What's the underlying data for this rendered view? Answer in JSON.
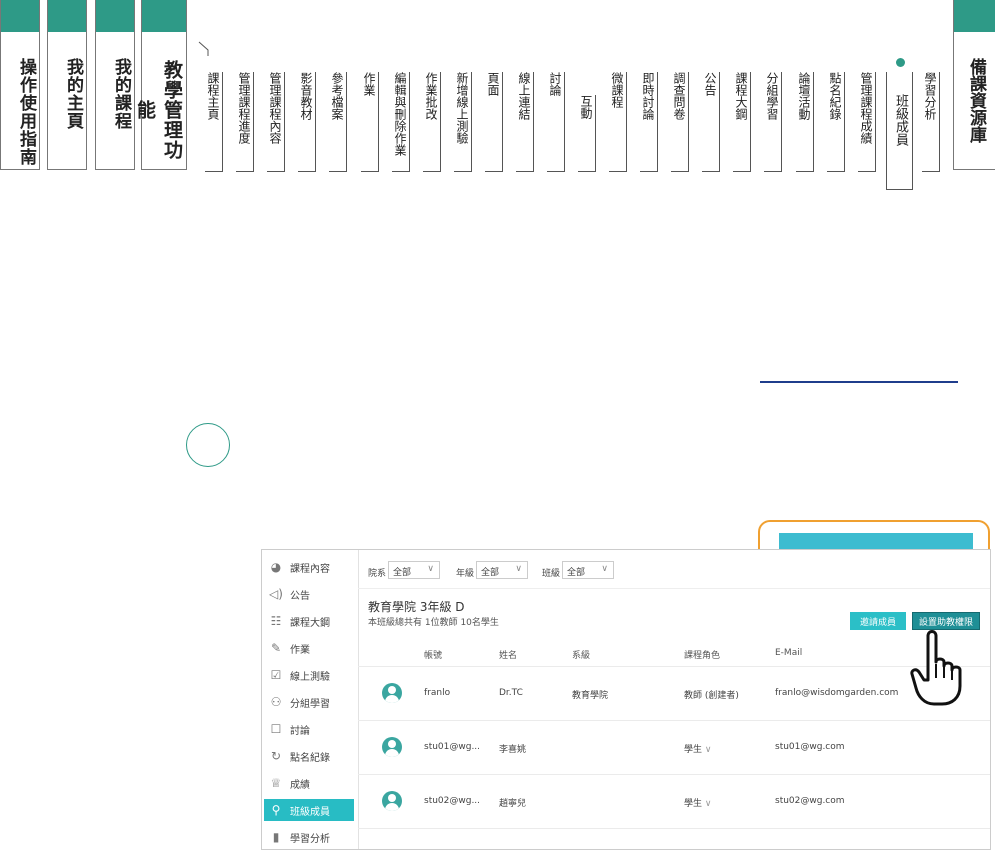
{
  "nav": {
    "guide": "操作使用指南",
    "home": "我的主頁",
    "courses": "我的課程",
    "teaching": "教學管理功能",
    "resources": "備課資源庫"
  },
  "tabs": [
    "課程主頁",
    "管理課程進度",
    "管理課程內容",
    "影音教材",
    "參考檔案",
    "作業",
    "編輯與刪除作業",
    "作業批改",
    "新增線上測驗",
    "頁面",
    "線上連結",
    "討論",
    "互動",
    "微課程",
    "即時討論",
    "調查問卷",
    "公告",
    "課程大鋼",
    "分組學習",
    "論壇活動",
    "點名紀錄",
    "管理課程成績"
  ],
  "active_tab": "班級成員",
  "last_tab": "學習分析",
  "sidebar": [
    "課程內容",
    "公告",
    "課程大鋼",
    "作業",
    "線上測驗",
    "分組學習",
    "討論",
    "點名紀錄",
    "成績",
    "班級成員",
    "學習分析"
  ],
  "filters": {
    "dept_label": "院系",
    "dept_value": "全部",
    "grade_label": "年級",
    "grade_value": "全部",
    "class_label": "班級",
    "class_value": "全部"
  },
  "class": {
    "title": "教育學院 3年級 D",
    "subtitle": "本班級總共有 1位教師 10名學生"
  },
  "buttons": {
    "invite": "邀請成員",
    "permission": "設置助教權限"
  },
  "table": {
    "headers": [
      "帳號",
      "姓名",
      "系級",
      "課程角色",
      "E-Mail"
    ],
    "rows": [
      {
        "account": "franlo",
        "name": "Dr.TC",
        "dept": "教育學院",
        "role": "教師 (創建者)",
        "email": "franlo@wisdomgarden.com"
      },
      {
        "account": "stu01@wg...",
        "name": "李喜姚",
        "dept": "",
        "role": "學生",
        "email": "stu01@wg.com"
      },
      {
        "account": "stu02@wg...",
        "name": "趙寧兒",
        "dept": "",
        "role": "學生",
        "email": "stu02@wg.com"
      }
    ]
  },
  "colors": {
    "accent": "#2e9a87",
    "teal": "#28bcc4",
    "callout": "#f0a030"
  }
}
